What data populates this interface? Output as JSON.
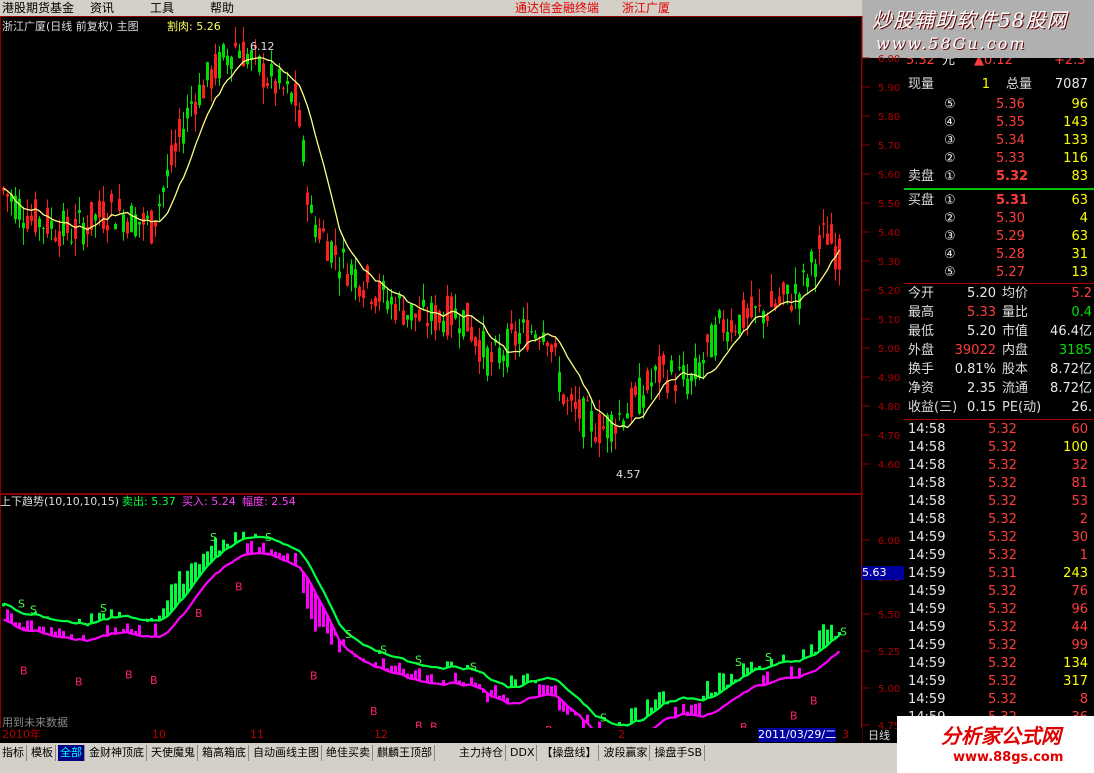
{
  "menubar": {
    "items": [
      "港股期货基金",
      "资讯",
      "工具",
      "帮助"
    ],
    "center_title": "通达信金融终端",
    "stock_title": "浙江广厦"
  },
  "banner": {
    "line1": "炒股辅助软件58股网",
    "line2": "www.58Gu.com"
  },
  "main_chart": {
    "caption_title": "浙江广厦(日线 前复权) 主图",
    "caption_indicator": "割肉: 5.26",
    "high_mark": "6.12",
    "low_mark": "4.57",
    "axis_labels": [
      "6.00",
      "5.90",
      "5.80",
      "5.70",
      "5.60",
      "5.50",
      "5.40",
      "5.30",
      "5.20",
      "5.10",
      "5.00",
      "4.90",
      "4.80",
      "4.70",
      "4.60"
    ]
  },
  "sub_chart": {
    "caption_name": "上下趋势(10,10,10,15)",
    "caption_sell": "卖出: 5.37",
    "caption_buy": "买入: 5.24",
    "caption_range": "幅度: 2.54",
    "axis_labels": [
      "6.00",
      "5.75",
      "5.50",
      "5.25",
      "5.00",
      "4.75",
      "4.50"
    ],
    "price_tag": "5.63",
    "watermark": "用到未来数据"
  },
  "x_axis": {
    "labels": [
      "2010年",
      "10",
      "11",
      "12",
      "2",
      "3"
    ],
    "cursor_date": "2011/03/29/二",
    "period": "日线"
  },
  "quote": {
    "price_row": {
      "price": "5.32",
      "unit": "元",
      "change": "▲0.12",
      "pct": "+2.3"
    },
    "xianliang": {
      "label": "现量",
      "value": "1",
      "label2": "总量",
      "value2": "7087"
    },
    "sell": [
      {
        "n": "⑤",
        "price": "5.36",
        "vol": "96"
      },
      {
        "n": "④",
        "price": "5.35",
        "vol": "143"
      },
      {
        "n": "③",
        "price": "5.34",
        "vol": "133"
      },
      {
        "n": "②",
        "price": "5.33",
        "vol": "116"
      },
      {
        "n": "①",
        "price": "5.32",
        "vol": "83"
      }
    ],
    "sell_label": "卖盘",
    "buy_label": "买盘",
    "buy": [
      {
        "n": "①",
        "price": "5.31",
        "vol": "63"
      },
      {
        "n": "②",
        "price": "5.30",
        "vol": "4"
      },
      {
        "n": "③",
        "price": "5.29",
        "vol": "63"
      },
      {
        "n": "④",
        "price": "5.28",
        "vol": "31"
      },
      {
        "n": "⑤",
        "price": "5.27",
        "vol": "13"
      }
    ],
    "stats": [
      {
        "l1": "今开",
        "v1": "5.20",
        "c1": "wht",
        "l2": "均价",
        "v2": "5.2",
        "c2": "red"
      },
      {
        "l1": "最高",
        "v1": "5.33",
        "c1": "red",
        "l2": "量比",
        "v2": "0.4",
        "c2": "grn"
      },
      {
        "l1": "最低",
        "v1": "5.20",
        "c1": "wht",
        "l2": "市值",
        "v2": "46.4亿",
        "c2": "wht"
      },
      {
        "l1": "外盘",
        "v1": "39022",
        "c1": "red",
        "l2": "内盘",
        "v2": "3185",
        "c2": "grn"
      },
      {
        "l1": "换手",
        "v1": "0.81%",
        "c1": "wht",
        "l2": "股本",
        "v2": "8.72亿",
        "c2": "wht"
      },
      {
        "l1": "净资",
        "v1": "2.35",
        "c1": "wht",
        "l2": "流通",
        "v2": "8.72亿",
        "c2": "wht"
      },
      {
        "l1": "收益(三)",
        "v1": "0.15",
        "c1": "wht",
        "l2": "PE(动)",
        "v2": "26.",
        "c2": "wht"
      }
    ],
    "ticks": [
      {
        "t": "14:58",
        "p": "5.32",
        "v": "60",
        "c": "red"
      },
      {
        "t": "14:58",
        "p": "5.32",
        "v": "100",
        "c": "yel"
      },
      {
        "t": "14:58",
        "p": "5.32",
        "v": "32",
        "c": "red"
      },
      {
        "t": "14:58",
        "p": "5.32",
        "v": "81",
        "c": "red"
      },
      {
        "t": "14:58",
        "p": "5.32",
        "v": "53",
        "c": "red"
      },
      {
        "t": "14:58",
        "p": "5.32",
        "v": "2",
        "c": "red"
      },
      {
        "t": "14:59",
        "p": "5.32",
        "v": "30",
        "c": "red"
      },
      {
        "t": "14:59",
        "p": "5.32",
        "v": "1",
        "c": "red"
      },
      {
        "t": "14:59",
        "p": "5.31",
        "v": "243",
        "c": "yel"
      },
      {
        "t": "14:59",
        "p": "5.32",
        "v": "76",
        "c": "red"
      },
      {
        "t": "14:59",
        "p": "5.32",
        "v": "96",
        "c": "red"
      },
      {
        "t": "14:59",
        "p": "5.32",
        "v": "44",
        "c": "red"
      },
      {
        "t": "14:59",
        "p": "5.32",
        "v": "99",
        "c": "red"
      },
      {
        "t": "14:59",
        "p": "5.32",
        "v": "134",
        "c": "yel"
      },
      {
        "t": "14:59",
        "p": "5.32",
        "v": "317",
        "c": "yel"
      },
      {
        "t": "14:59",
        "p": "5.32",
        "v": "8",
        "c": "red"
      },
      {
        "t": "14:59",
        "p": "5.32",
        "v": "36",
        "c": "red"
      }
    ]
  },
  "tabs": [
    "指标",
    "模板",
    "全部",
    "金财神顶底",
    "天使魔鬼",
    "箱高箱底",
    "自动画线主图",
    "绝佳买卖",
    "麒麟王顶部",
    "主力持仓",
    "DDX",
    "【操盘线】",
    "波段赢家",
    "操盘手SB"
  ],
  "tab_active": 2,
  "logo": {
    "main": "分析家公式网",
    "url": "www.88gs.com"
  },
  "colors": {
    "up": "#ff1e1e",
    "down": "#00e000",
    "ma": "#ffff80",
    "upper": "#00ff40",
    "lower": "#ff00ff",
    "grid": "#8b0000"
  }
}
